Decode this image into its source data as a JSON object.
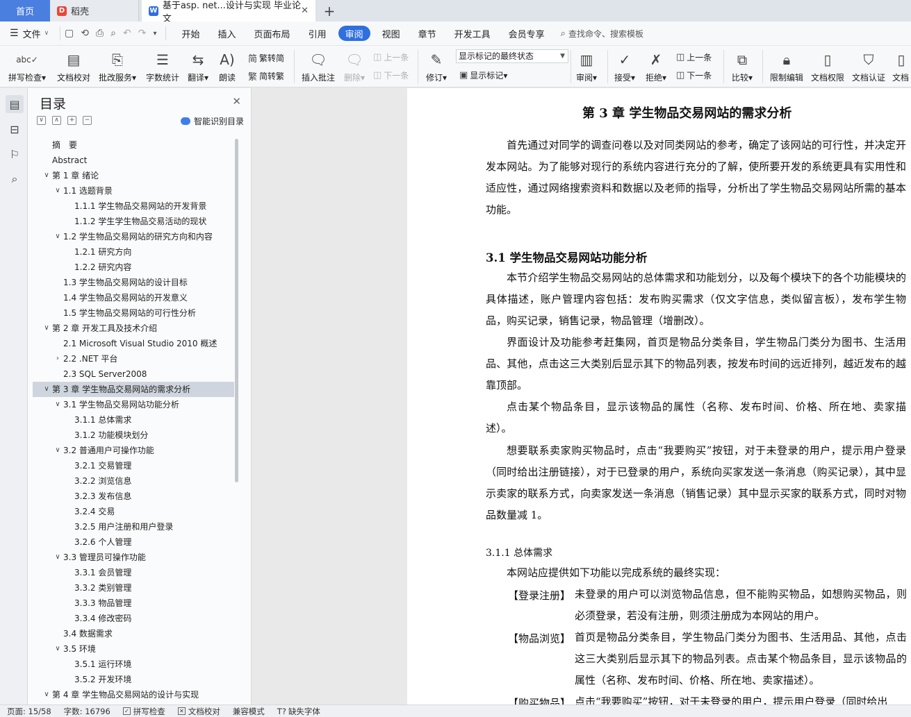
{
  "tabs": {
    "home": "首页",
    "daoke": "稻壳",
    "doc": "基于asp. net...设计与实现 毕业论文",
    "close": "✕",
    "add": "+"
  },
  "menu": {
    "file": "文件",
    "tabs": [
      "开始",
      "插入",
      "页面布局",
      "引用",
      "审阅",
      "视图",
      "章节",
      "开发工具",
      "会员专享"
    ],
    "active_tab": "审阅",
    "search": "查找命令、搜索模板"
  },
  "ribbon": {
    "spellcheck": "拼写检查",
    "doc_proof": "文档校对",
    "review_service": "批改服务",
    "word_count": "字数统计",
    "translate": "翻译",
    "read_aloud": "朗读",
    "to_traditional": "繁转简",
    "to_simplified": "简转繁",
    "insert_comment": "插入批注",
    "delete": "删除",
    "prev_comment": "上一条",
    "next_comment": "下一条",
    "revise": "修订",
    "display_mode": "显示标记的最终状态",
    "show_marks": "显示标记",
    "review": "审阅",
    "accept": "接受",
    "reject": "拒绝",
    "prev_change": "上一条",
    "next_change": "下一条",
    "compare": "比较",
    "restrict_edit": "限制编辑",
    "doc_permission": "文档权限",
    "doc_certify": "文档认证",
    "doc_more": "文档"
  },
  "toc": {
    "title": "目录",
    "smart": "智能识别目录",
    "items": [
      {
        "text": "摘　要",
        "level": 0,
        "chev": ""
      },
      {
        "text": "Abstract",
        "level": 0,
        "chev": ""
      },
      {
        "text": "第 1 章  绪论",
        "level": 0,
        "chev": "v"
      },
      {
        "text": "1.1 选题背景",
        "level": 1,
        "chev": "v"
      },
      {
        "text": "1.1.1 学生物品交易网站的开发背景",
        "level": 2,
        "chev": ""
      },
      {
        "text": "1.1.2 学生学生物品交易活动的现状",
        "level": 2,
        "chev": ""
      },
      {
        "text": "1.2  学生物品交易网站的研究方向和内容",
        "level": 1,
        "chev": "v"
      },
      {
        "text": "1.2.1 研究方向",
        "level": 2,
        "chev": ""
      },
      {
        "text": "1.2.2 研究内容",
        "level": 2,
        "chev": ""
      },
      {
        "text": "1.3  学生物品交易网站的设计目标",
        "level": 1,
        "chev": ""
      },
      {
        "text": "1.4  学生物品交易网站的开发意义",
        "level": 1,
        "chev": ""
      },
      {
        "text": "1.5  学生物品交易网站的可行性分析",
        "level": 1,
        "chev": ""
      },
      {
        "text": "第 2 章  开发工具及技术介绍",
        "level": 0,
        "chev": "v"
      },
      {
        "text": "2.1 Microsoft Visual Studio 2010 概述",
        "level": 1,
        "chev": ""
      },
      {
        "text": "2.2 .NET 平台",
        "level": 1,
        "chev": ">"
      },
      {
        "text": "2.3 SQL Server2008",
        "level": 1,
        "chev": ""
      },
      {
        "text": "第 3 章  学生物品交易网站的需求分析",
        "level": 0,
        "chev": "v",
        "selected": true
      },
      {
        "text": "3.1 学生物品交易网站功能分析",
        "level": 1,
        "chev": "v"
      },
      {
        "text": "3.1.1 总体需求",
        "level": 2,
        "chev": ""
      },
      {
        "text": "3.1.2 功能模块划分",
        "level": 2,
        "chev": ""
      },
      {
        "text": "3.2 普通用户可操作功能",
        "level": 1,
        "chev": "v"
      },
      {
        "text": "3.2.1 交易管理",
        "level": 2,
        "chev": ""
      },
      {
        "text": "3.2.2 浏览信息",
        "level": 2,
        "chev": ""
      },
      {
        "text": "3.2.3 发布信息",
        "level": 2,
        "chev": ""
      },
      {
        "text": "3.2.4  交易",
        "level": 2,
        "chev": ""
      },
      {
        "text": "3.2.5 用户注册和用户登录",
        "level": 2,
        "chev": ""
      },
      {
        "text": "3.2.6 个人管理",
        "level": 2,
        "chev": ""
      },
      {
        "text": "3.3 管理员可操作功能",
        "level": 1,
        "chev": "v"
      },
      {
        "text": "3.3.1 会员管理",
        "level": 2,
        "chev": ""
      },
      {
        "text": "3.3.2 类别管理",
        "level": 2,
        "chev": ""
      },
      {
        "text": "3.3.3 物品管理",
        "level": 2,
        "chev": ""
      },
      {
        "text": "3.3.4  修改密码",
        "level": 2,
        "chev": ""
      },
      {
        "text": "3.4 数据需求",
        "level": 1,
        "chev": ""
      },
      {
        "text": "3.5 环境",
        "level": 1,
        "chev": "v"
      },
      {
        "text": "3.5.1 运行环境",
        "level": 2,
        "chev": ""
      },
      {
        "text": "3.5.2 开发环境",
        "level": 2,
        "chev": ""
      },
      {
        "text": "第 4 章  学生物品交易网站的设计与实现",
        "level": 0,
        "chev": "v"
      }
    ]
  },
  "doc": {
    "chapter_title": "第 3 章  学生物品交易网站的需求分析",
    "p1": "首先通过对同学的调查问卷以及对同类网站的参考，确定了该网站的可行性，并决定开发本网站。为了能够对现行的系统内容进行充分的了解，使所要开发的系统更具有实用性和适应性，通过网络搜索资料和数据以及老师的指导，分析出了学生物品交易网站所需的基本功能。",
    "h31": "3.1 学生物品交易网站功能分析",
    "p2": "本节介绍学生物品交易网站的总体需求和功能划分，以及每个模块下的各个功能模块的具体描述，账户管理内容包括：发布购买需求（仅文字信息，类似留言板），发布学生物品，购买记录，销售记录，物品管理（增删改）。",
    "p3": "界面设计及功能参考赶集网，首页是物品分类条目，学生物品门类分为图书、生活用品、其他，点击这三大类别后显示其下的物品列表，按发布时间的远近排列，越近发布的越靠顶部。",
    "p4": "点击某个物品条目，显示该物品的属性（名称、发布时间、价格、所在地、卖家描述）。",
    "p5": "想要联系卖家购买物品时，点击“我要购买”按钮，对于未登录的用户，提示用户登录（同时给出注册链接），对于已登录的用户，系统向买家发送一条消息（购买记录），其中显示卖家的联系方式，向卖家发送一条消息（销售记录）其中显示买家的联系方式，同时对物品数量减 1。",
    "h311": "3.1.1 总体需求",
    "p6": "本网站应提供如下功能以完成系统的最终实现：",
    "def1_key": "【登录注册】",
    "def1_val": "未登录的用户可以浏览物品信息，但不能购买物品，如想购买物品，则必须登录，若没有注册，则须注册成为本网站的用户。",
    "def2_key": "【物品浏览】",
    "def2_val": "首页是物品分类条目，学生物品门类分为图书、生活用品、其他，点击这三大类别后显示其下的物品列表。点击某个物品条目，显示该物品的属性（名称、发布时间、价格、所在地、卖家描述）。",
    "def3_key": "【购买物品】",
    "def3_val": "点击“我要购买”按钮，对于未登录的用户，提示用户登录（同时给出"
  },
  "status": {
    "page": "页面: 15/58",
    "words": "字数: 16796",
    "spell": "拼写检查",
    "proof": "文档校对",
    "compat": "兼容模式",
    "missing_font": "缺失字体"
  },
  "colors": {
    "accent": "#2f6fde",
    "home_tab": "#4a7fe0",
    "toc_selected": "#cfd5de"
  }
}
